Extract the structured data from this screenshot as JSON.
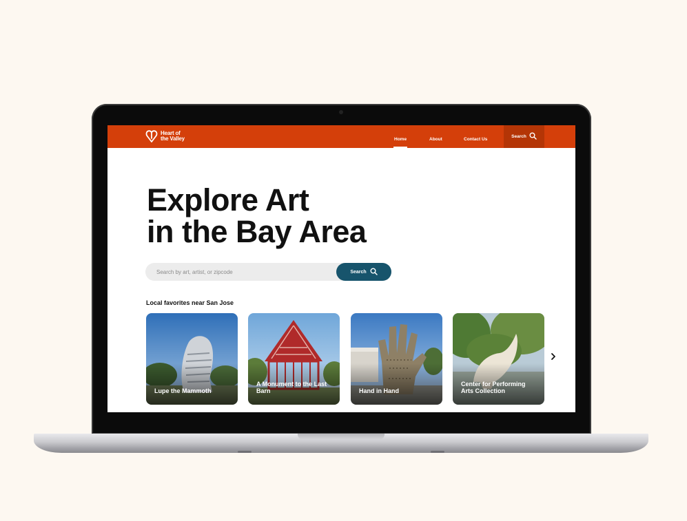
{
  "site": {
    "logo_line1": "Heart of",
    "logo_line2": "the Valley",
    "brand_color": "#d43f0a",
    "accent_color": "#17546c"
  },
  "nav": {
    "home": "Home",
    "about": "About",
    "contact": "Contact Us",
    "search": "Search"
  },
  "hero": {
    "title_line1": "Explore Art",
    "title_line2": "in the Bay Area"
  },
  "search": {
    "placeholder": "Search by art, artist, or zipcode",
    "button_label": "Search"
  },
  "favorites": {
    "heading": "Local favorites near San Jose",
    "cards": [
      {
        "title": "Lupe the Mammoth"
      },
      {
        "title": "A Monument to the Last Barn"
      },
      {
        "title": "Hand in Hand"
      },
      {
        "title": "Center for Performing Arts Collection"
      }
    ]
  }
}
